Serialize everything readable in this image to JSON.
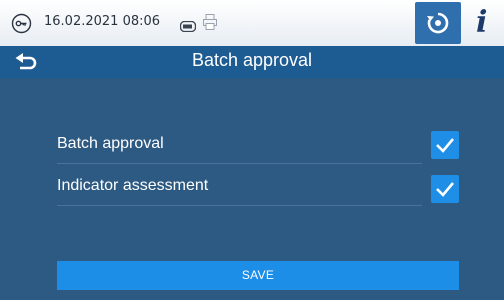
{
  "status_bar": {
    "datetime": "16.02.2021 08:06",
    "icons": [
      "key-icon",
      "card-icon",
      "printer-icon"
    ],
    "program_button_icon": "cycle-icon",
    "info_button_glyph": "i"
  },
  "header": {
    "back_icon": "back-arrow-icon",
    "title": "Batch approval"
  },
  "options": [
    {
      "label": "Batch approval",
      "checked": true
    },
    {
      "label": "Indicator assessment",
      "checked": true
    }
  ],
  "actions": {
    "save_label": "SAVE"
  },
  "colors": {
    "background": "#2d5a82",
    "header": "#1d5b93",
    "accent": "#1f8ee6",
    "status_bar": "#ffffff"
  }
}
